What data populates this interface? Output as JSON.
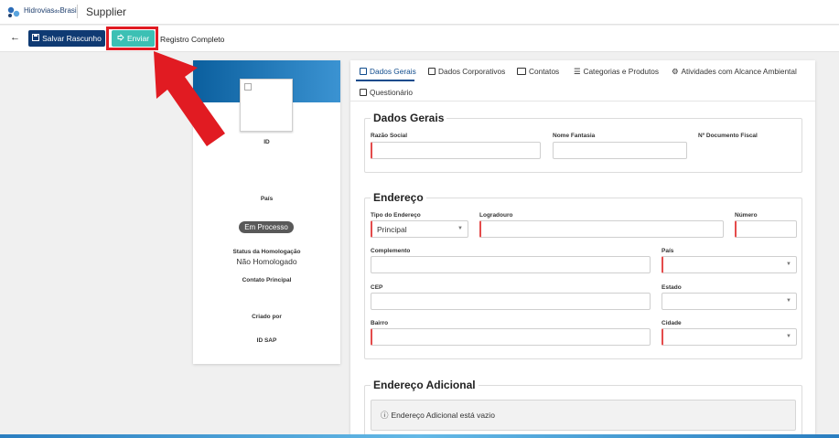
{
  "header": {
    "logo_main": "Hidrovias",
    "logo_small": "do",
    "logo_brand": "Brasil",
    "app_name": "Supplier"
  },
  "toolbar": {
    "back_icon": "arrow-left-icon",
    "save_draft_label": "Salvar Rascunho",
    "send_label": "Enviar",
    "registration_label": "Registro Completo"
  },
  "profile": {
    "id_label": "ID",
    "country_label": "País",
    "status_badge": "Em Processo",
    "homologation_label": "Status da Homologação",
    "homologation_value": "Não Homologado",
    "main_contact_label": "Contato Principal",
    "created_by_label": "Criado por",
    "sap_id_label": "ID SAP"
  },
  "tabs": [
    "Dados Gerais",
    "Dados Corporativos",
    "Contatos",
    "Categorias e Produtos",
    "Atividades com Alcance Ambiental",
    "Questionário"
  ],
  "general": {
    "title": "Dados Gerais",
    "company_name": "Razão Social",
    "trade_name": "Nome Fantasia",
    "tax_doc": "Nº Documento Fiscal"
  },
  "address": {
    "title": "Endereço",
    "type_label": "Tipo do Endereço",
    "type_value": "Principal",
    "street": "Logradouro",
    "number": "Número",
    "complement": "Complemento",
    "country": "País",
    "zip": "CEP",
    "state": "Estado",
    "district": "Bairro",
    "city": "Cidade"
  },
  "additional": {
    "title": "Endereço Adicional",
    "empty_text": "Endereço Adicional está vazio"
  },
  "colors": {
    "primary": "#0f3a73",
    "send": "#3cc0b4",
    "highlight": "#e11b22",
    "banner": "#0b5f9e"
  }
}
